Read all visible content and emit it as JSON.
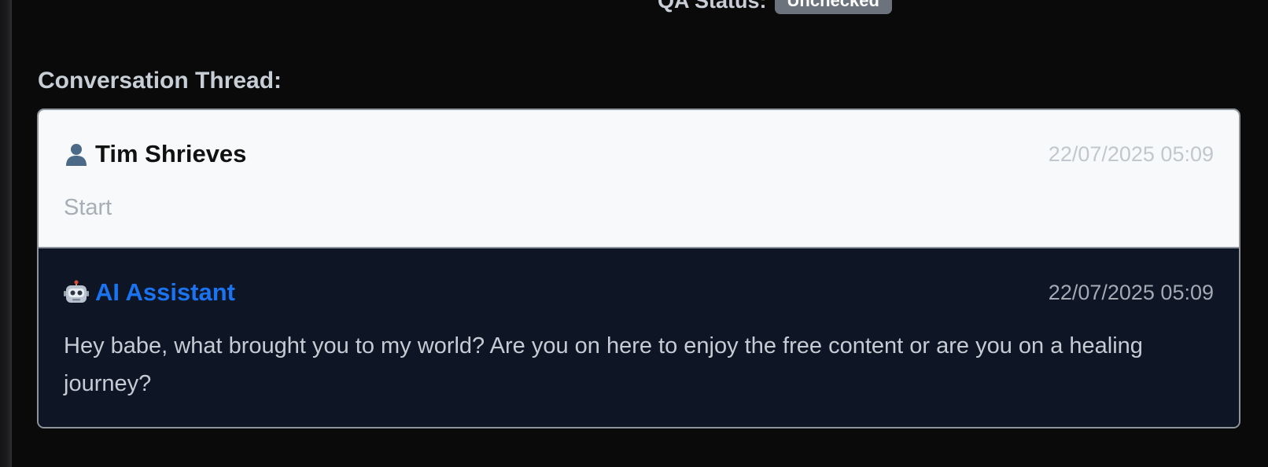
{
  "qa": {
    "label": "QA Status:",
    "badge": "Unchecked"
  },
  "section": {
    "title": "Conversation Thread:"
  },
  "messages": [
    {
      "author": "Tim Shrieves",
      "icon": "user-silhouette-icon",
      "timestamp": "22/07/2025 05:09",
      "text": "Start"
    },
    {
      "author": "AI Assistant",
      "icon": "robot-icon",
      "timestamp": "22/07/2025 05:09",
      "text": "Hey babe, what brought you to my world? Are you on here to enjoy the free content or are you on a healing journey?"
    }
  ],
  "colors": {
    "page_bg": "#0a0a0b",
    "ai_accent": "#1a73f0",
    "ai_bg": "#0e1524",
    "user_bg": "#f8f9fb",
    "badge_bg": "#6c737c"
  }
}
